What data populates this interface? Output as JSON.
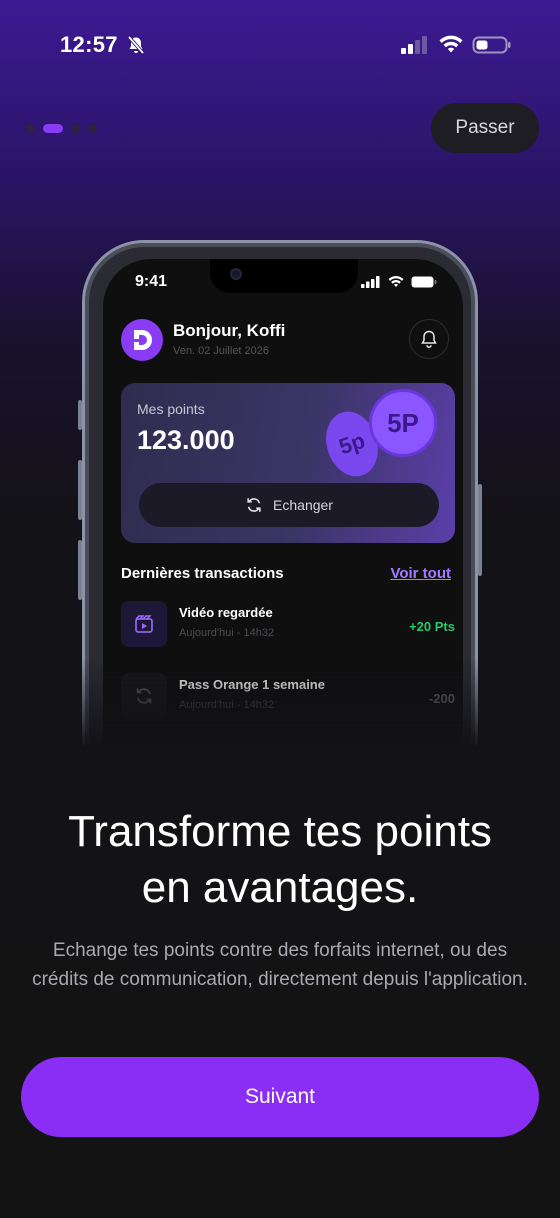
{
  "status_bar": {
    "time": "12:57"
  },
  "onboarding": {
    "skip_label": "Passer",
    "page_count": 4,
    "active_page": 2,
    "headline_line1": "Transforme tes points",
    "headline_line2": "en avantages.",
    "description": "Echange tes points contre des forfaits internet, ou des crédits de communication, directement depuis l'application.",
    "next_label": "Suivant"
  },
  "phone_mock": {
    "time": "9:41",
    "avatar_letter": "D",
    "greeting": "Bonjour, Koffi",
    "date": "Ven. 02 Juillet 2026",
    "points_label": "Mes points",
    "points_value": "123.000",
    "coin_front": "5P",
    "coin_back": "5p",
    "exchange_label": "Echanger",
    "transactions_title": "Dernières transactions",
    "see_all_label": "Voir tout",
    "transactions": [
      {
        "name": "Vidéo regardée",
        "time": "Aujourd'hui - 14h32",
        "amount": "+20 Pts"
      },
      {
        "name": "Pass Orange 1 semaine",
        "time": "Aujourd'hui - 14h32",
        "amount": "-200"
      }
    ]
  },
  "colors": {
    "accent": "#8a2ef5",
    "positive": "#2bc76a",
    "background_top": "#3d1a93",
    "background_bottom": "#131313"
  }
}
